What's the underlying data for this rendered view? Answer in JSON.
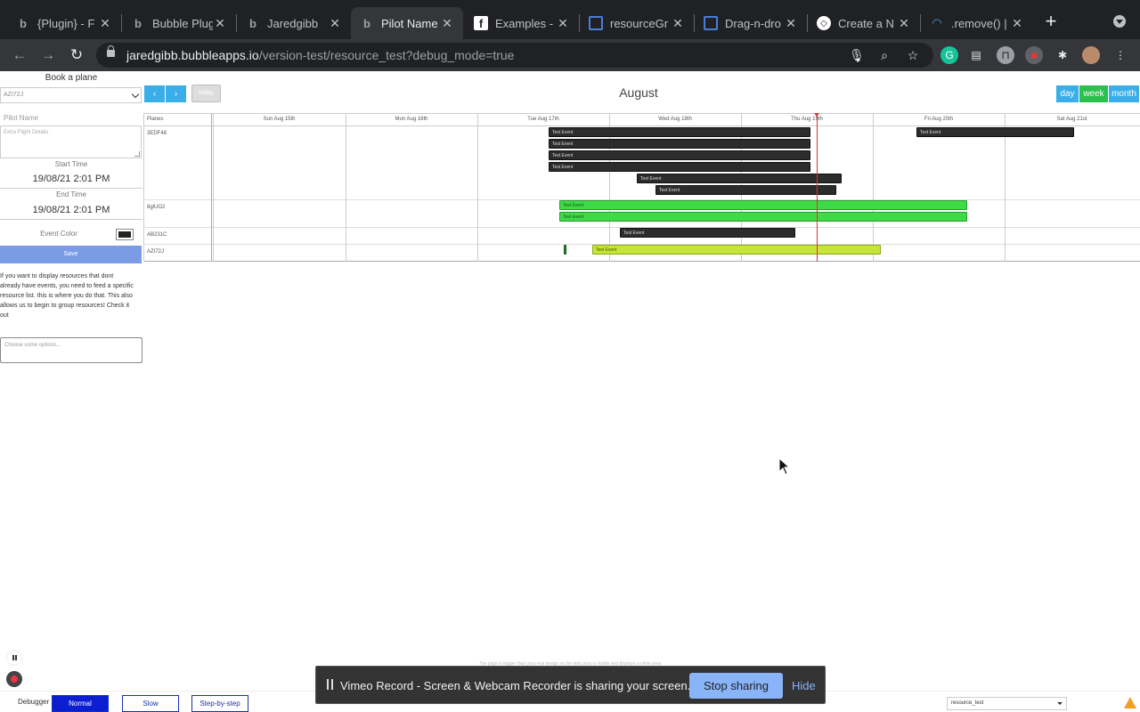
{
  "browser": {
    "tabs": [
      {
        "title": "{Plugin} - F",
        "icon": "bubble-icon"
      },
      {
        "title": "Bubble Plug",
        "icon": "bubble-icon"
      },
      {
        "title": "Jaredgibb",
        "icon": "bubble-icon"
      },
      {
        "title": "Pilot Name",
        "icon": "bubble-icon"
      },
      {
        "title": "Examples -",
        "icon": "facebook-icon"
      },
      {
        "title": "resourceGr",
        "icon": "doc-icon"
      },
      {
        "title": "Drag-n-dro",
        "icon": "doc-icon"
      },
      {
        "title": "Create a N",
        "icon": "codepen-icon"
      },
      {
        "title": ".remove() |",
        "icon": "jquery-icon"
      }
    ],
    "url_host": "jaredgibb.bubbleapps.io",
    "url_path": "/version-test/resource_test?debug_mode=true"
  },
  "form": {
    "title": "Book a plane",
    "plane_select": "AZI72J",
    "pilot_name_placeholder": "Pilot Name",
    "details_placeholder": "Extra Flight Details",
    "start_label": "Start Time",
    "start_value": "19/08/21 2:01 PM",
    "end_label": "End Time",
    "end_value": "19/08/21 2:01 PM",
    "color_label": "Event Color",
    "event_color": "#222222",
    "save_label": "Save",
    "help_text": "If you want to display resources that dont already have events, you need to feed a specific resource list. this is where you do that. This also allows us to begin to group resources! Check it out",
    "multi_placeholder": "Choose some options..."
  },
  "calendar": {
    "prev_icon": "‹",
    "next_icon": "›",
    "today_label": "today",
    "month_title": "August",
    "views": [
      "day",
      "week",
      "month"
    ],
    "active_view": "week",
    "resource_header": "Planes",
    "days": [
      "Sun Aug 15th",
      "Mon Aug 16th",
      "Tue Aug 17th",
      "Wed Aug 18th",
      "Thu Aug 19th",
      "Fri Aug 20th",
      "Sat Aug 21st"
    ],
    "resources": [
      "3EDF48",
      "8glUO2",
      "AB231C",
      "AZI72J"
    ],
    "event_label": "Test Event",
    "colors": {
      "dark": "#2c2c2c",
      "green": "#3ddc46",
      "lime": "#c7e43a",
      "now": "#dd3333",
      "view_btn": "#3aaee8",
      "view_active": "#2bbf4d"
    }
  },
  "debugger": {
    "label": "Debugger",
    "modes": [
      "Normal",
      "Slow",
      "Step-by-step"
    ],
    "active_mode": "Normal",
    "page": "resource_test",
    "faint_note": "The page is bigger than your real design so the dots your is visible and displays a white area"
  },
  "vimeo": {
    "message": "Vimeo Record - Screen & Webcam Recorder is sharing your screen.",
    "stop_label": "Stop sharing",
    "hide_label": "Hide"
  }
}
